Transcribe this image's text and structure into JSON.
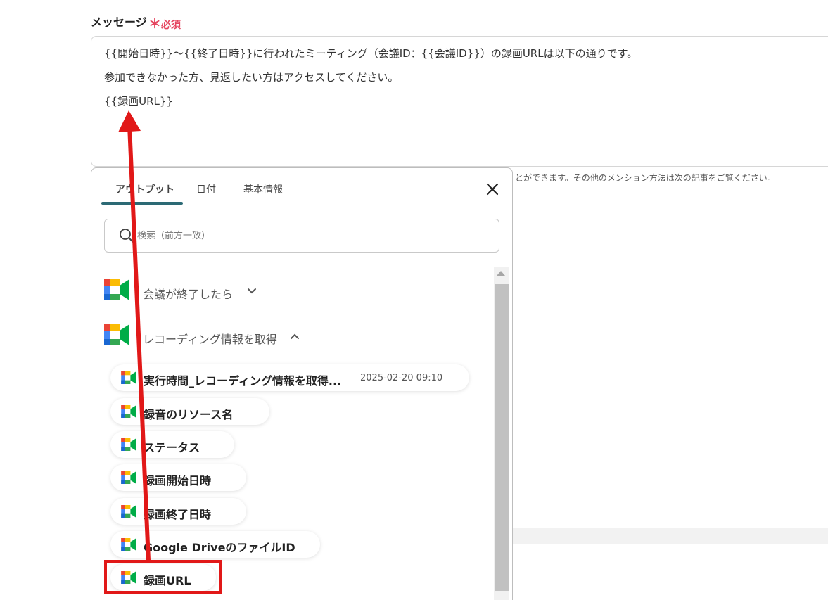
{
  "field": {
    "label": "メッセージ",
    "required_star": "＊",
    "required_text": "必須"
  },
  "message": {
    "lines": [
      "{{開始日時}}〜{{終了日時}}に行われたミーティング（会議ID：{{会議ID}}）の録画URLは以下の通りです。",
      "参加できなかった方、見返したい方はアクセスしてください。",
      "{{録画URL}}"
    ]
  },
  "helper_text": "とができます。その他のメンション方法は次の記事をご覧ください。",
  "popup": {
    "tabs": [
      {
        "label": "アウトプット",
        "active": true
      },
      {
        "label": "日付",
        "active": false
      },
      {
        "label": "基本情報",
        "active": false
      }
    ],
    "search": {
      "placeholder": "検索（前方一致）",
      "value": ""
    },
    "groups": [
      {
        "label": "会議が終了したら",
        "expanded": false,
        "icon": "google-meet-icon"
      },
      {
        "label": "レコーディング情報を取得",
        "expanded": true,
        "icon": "google-meet-icon"
      }
    ],
    "items": [
      {
        "label": "実行時間_レコーディング情報を取得...",
        "meta": "2025-02-20 09:10"
      },
      {
        "label": "録音のリソース名",
        "meta": ""
      },
      {
        "label": "ステータス",
        "meta": ""
      },
      {
        "label": "録画開始日時",
        "meta": ""
      },
      {
        "label": "録画終了日時",
        "meta": ""
      },
      {
        "label": "Google DriveのファイルID",
        "meta": ""
      },
      {
        "label": "録画URL",
        "meta": "",
        "highlighted": true
      }
    ]
  },
  "colors": {
    "accent_tab": "#2c6a75",
    "required": "#e5455f",
    "annotation_red": "#e11818"
  }
}
